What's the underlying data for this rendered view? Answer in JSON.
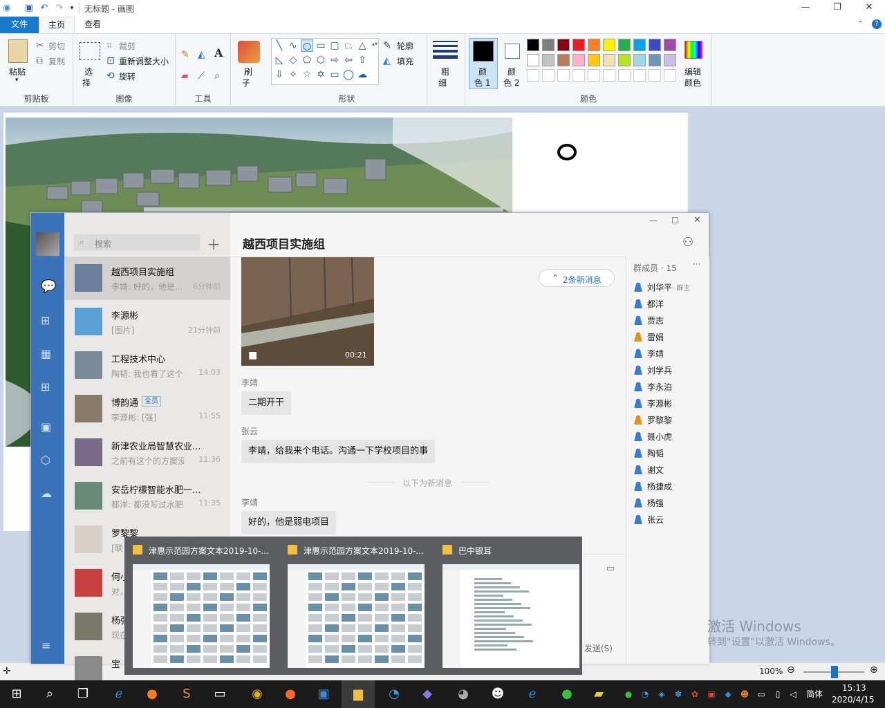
{
  "window": {
    "title": "无标题 - 画图",
    "minimize_glyph": "—",
    "maximize_glyph": "❐",
    "close_glyph": "✕"
  },
  "tabs": {
    "file": "文件",
    "home": "主页",
    "view": "查看"
  },
  "ribbon": {
    "clipboard": {
      "paste": "粘贴",
      "cut": "剪切",
      "copy": "复制",
      "label": "剪贴板"
    },
    "image": {
      "select": "选",
      "select2": "择",
      "crop": "裁剪",
      "resize": "重新调整大小",
      "rotate": "旋转",
      "label": "图像"
    },
    "tools": {
      "label": "工具"
    },
    "brush": {
      "label1": "刷",
      "label2": "子"
    },
    "shapes": {
      "outline": "轮廓",
      "fill": "填充",
      "label": "形状"
    },
    "size": {
      "l1": "粗",
      "l2": "细"
    },
    "color1": {
      "l1": "颜",
      "l2": "色 1"
    },
    "color2": {
      "l1": "颜",
      "l2": "色 2"
    },
    "edit_colors": {
      "l1": "编辑",
      "l2": "颜色"
    },
    "colors_label": "颜色",
    "palette_row1": [
      "#000000",
      "#7f7f7f",
      "#880015",
      "#ed1c24",
      "#ff7f27",
      "#fff200",
      "#22b14c",
      "#00a2e8",
      "#3f48cc",
      "#a349a4"
    ],
    "palette_row2": [
      "#ffffff",
      "#c3c3c3",
      "#b97a57",
      "#ffaec9",
      "#ffc90e",
      "#efe4b0",
      "#b5e61d",
      "#99d9ea",
      "#7092be",
      "#c8bfe7"
    ]
  },
  "paint_status": {
    "zoom": "100%"
  },
  "wechat": {
    "search_placeholder": "搜索",
    "chat_title": "越西项目实施组",
    "new_msgs_button": "2条新消息",
    "video_duration": "00:21",
    "new_msg_divider": "以下为新消息",
    "send_label": "发送(S)",
    "members_header": "群成员 · 15",
    "chats": [
      {
        "name": "越西项目实施组",
        "preview": "李靖: 好的，他是...",
        "time": "6分钟前"
      },
      {
        "name": "李源彬",
        "preview": "[图片]",
        "time": "21分钟前"
      },
      {
        "name": "工程技术中心",
        "preview": "陶韬: 我也看了这个...",
        "time": "14:03"
      },
      {
        "name": "博韵通",
        "badge": "全员",
        "preview": "李源彬: [强]",
        "time": "11:55"
      },
      {
        "name": "新津农业局智慧农业...",
        "preview": "之前有这个的方案没。",
        "time": "11:36"
      },
      {
        "name": "安岳柠檬智能水肥一...",
        "preview": "都洋: 都没写过水肥...",
        "time": "11:35"
      },
      {
        "name": "罗黎黎",
        "preview": "[联",
        "time": ""
      },
      {
        "name": "何小",
        "preview": "对，",
        "time": ""
      },
      {
        "name": "杨强",
        "preview": "现在",
        "time": ""
      },
      {
        "name": "宝",
        "preview": "",
        "time": ""
      }
    ],
    "messages": [
      {
        "sender": "李靖",
        "text": "二期开干"
      },
      {
        "sender": "张云",
        "text": "李靖，给我来个电话。沟通一下学校项目的事"
      },
      {
        "sender": "李靖",
        "text": "好的，他是弱电项目"
      }
    ],
    "members": [
      {
        "name": "刘华平",
        "tag": "· 群主"
      },
      {
        "name": "都洋"
      },
      {
        "name": "贾志"
      },
      {
        "name": "雷娟"
      },
      {
        "name": "李靖"
      },
      {
        "name": "刘学兵"
      },
      {
        "name": "李永泊"
      },
      {
        "name": "李源彬"
      },
      {
        "name": "罗黎黎"
      },
      {
        "name": "聂小虎"
      },
      {
        "name": "陶韬"
      },
      {
        "name": "谢文"
      },
      {
        "name": "杨捷成"
      },
      {
        "name": "杨强"
      },
      {
        "name": "张云"
      }
    ]
  },
  "thumbnails": [
    {
      "title": "津惠示范园方案文本2019-10-..."
    },
    {
      "title": "津惠示范园方案文本2019-10-..."
    },
    {
      "title": "巴中银耳"
    }
  ],
  "watermark": {
    "line1": "激活 Windows",
    "line2": "转到\"设置\"以激活 Windows。"
  },
  "taskbar": {
    "ime": "简体",
    "time": "15:13",
    "date": "2020/4/15"
  }
}
